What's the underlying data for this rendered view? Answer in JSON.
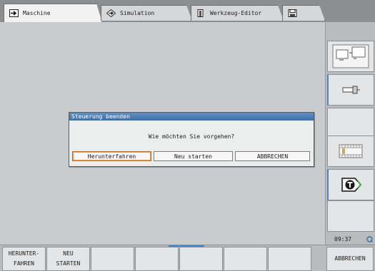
{
  "tabs": [
    {
      "label": "Maschine",
      "icon": "arrow-right-icon",
      "active": true
    },
    {
      "label": "Simulation",
      "icon": "diamond-arrow-icon",
      "active": false
    },
    {
      "label": "Werkzeug-Editor",
      "icon": "tool-holder-icon",
      "active": false
    },
    {
      "label": "",
      "icon": "save-disk-icon",
      "active": false
    }
  ],
  "dialog": {
    "title": "Steuerung beenden",
    "message": "Wie möchten Sie vorgehen?",
    "buttons": [
      "Herunterfahren",
      "Neu starten",
      "ABBRECHEN"
    ]
  },
  "right_softkeys": [
    {
      "icon": "window-layout-icon"
    },
    {
      "icon": "plug-connector-icon"
    },
    {
      "icon": ""
    },
    {
      "icon": "film-strip-icon"
    },
    {
      "icon": "tool-t-icon"
    },
    {
      "icon": ""
    }
  ],
  "clock": "09:37",
  "bottom_softkeys": [
    {
      "line1": "HERUNTER-",
      "line2": "FAHREN"
    },
    {
      "line1": "NEU",
      "line2": "STARTEN"
    },
    {
      "line1": "",
      "line2": ""
    },
    {
      "line1": "",
      "line2": ""
    },
    {
      "line1": "",
      "line2": ""
    },
    {
      "line1": "",
      "line2": ""
    },
    {
      "line1": "",
      "line2": ""
    },
    {
      "line1": "ABBRECHEN",
      "line2": ""
    }
  ],
  "colors": {
    "accent": "#4c86c2",
    "dialog_title_bg": "#3d6fa8",
    "background": "#c9cbcd"
  }
}
